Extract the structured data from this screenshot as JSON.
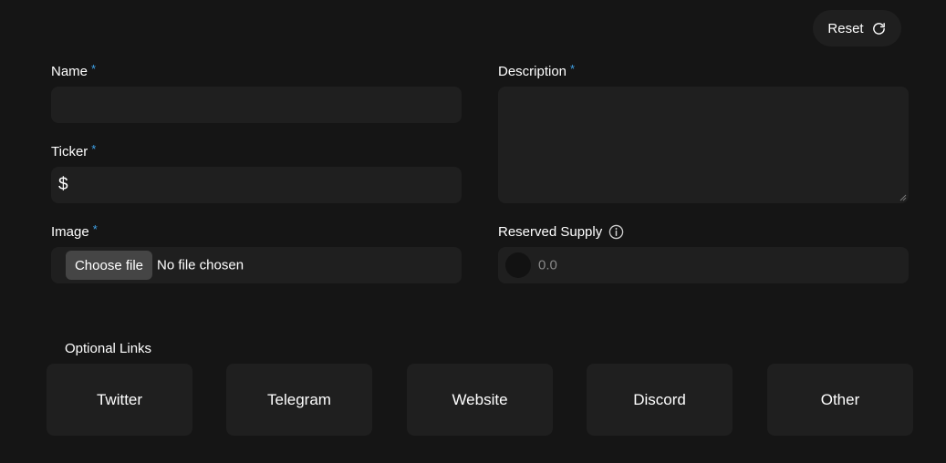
{
  "reset": {
    "label": "Reset",
    "icon": "refresh-icon"
  },
  "form": {
    "required_marker": "*",
    "name": {
      "label": "Name",
      "value": "",
      "placeholder": ""
    },
    "ticker": {
      "label": "Ticker",
      "prefix": "$",
      "value": "",
      "placeholder": ""
    },
    "image": {
      "label": "Image",
      "button_label": "Choose file",
      "status": "No file chosen"
    },
    "description": {
      "label": "Description",
      "value": "",
      "placeholder": ""
    },
    "reserved_supply": {
      "label": "Reserved Supply",
      "info_icon": "info-icon",
      "value": "0.0"
    }
  },
  "optional_links": {
    "title": "Optional Links",
    "items": [
      {
        "label": "Twitter"
      },
      {
        "label": "Telegram"
      },
      {
        "label": "Website"
      },
      {
        "label": "Discord"
      },
      {
        "label": "Other"
      }
    ]
  },
  "colors": {
    "background": "#151515",
    "surface": "#1f1f1f",
    "required_accent": "#3fa2e8",
    "file_button": "#454545"
  }
}
